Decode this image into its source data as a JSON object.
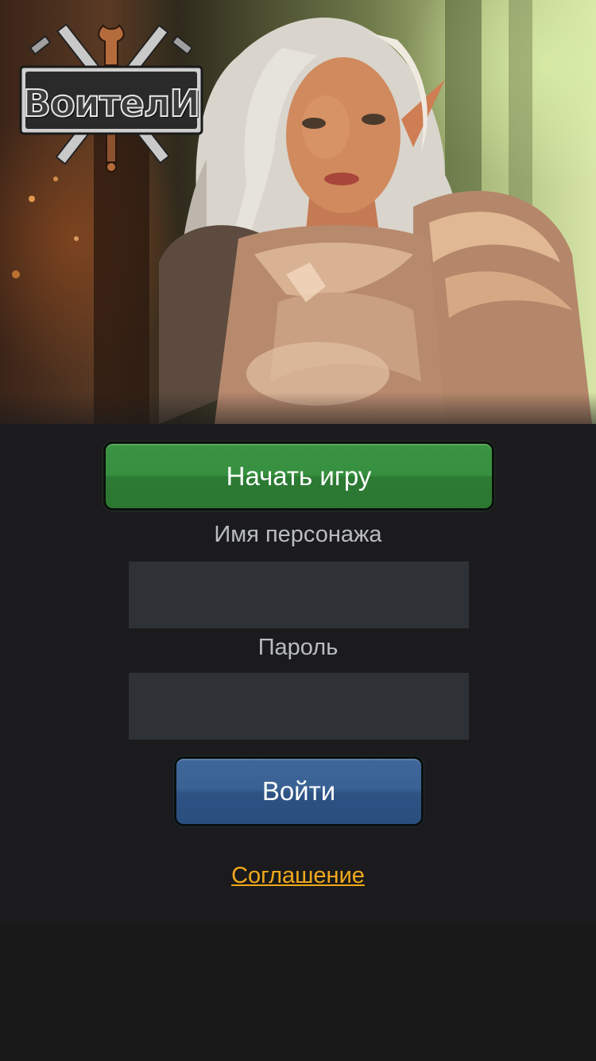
{
  "logo": {
    "text": "ВоителИ"
  },
  "hero": {
    "image": "warrior-elf-in-armor"
  },
  "start_button": {
    "label": "Начать игру"
  },
  "login_form": {
    "name_label": "Имя персонажа",
    "name_value": "",
    "password_label": "Пароль",
    "password_value": ""
  },
  "login_button": {
    "label": "Войти"
  },
  "agreement_link": {
    "label": "Соглашение"
  },
  "colors": {
    "background": "#1b1b1d",
    "start_button": "#36903f",
    "login_button": "#3a6193",
    "input_bg": "#2e3135",
    "label_text": "#b9bcc2",
    "link": "#f0a91a"
  }
}
